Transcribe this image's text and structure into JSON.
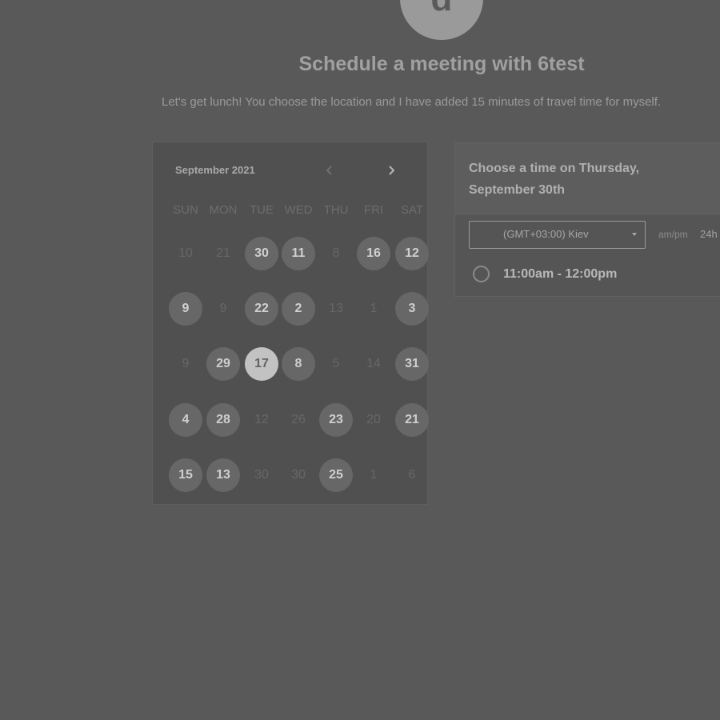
{
  "header": {
    "avatar_letter": "d",
    "title": "Schedule a meeting with 6test",
    "description": "Let's get lunch! You choose the location and I have added 15 minutes of travel time for myself."
  },
  "calendar": {
    "month_label": "September 2021",
    "prev_icon": "chevron-left-icon",
    "next_icon": "chevron-right-icon",
    "weekdays": [
      "SUN",
      "MON",
      "TUE",
      "WED",
      "THU",
      "FRI",
      "SAT"
    ],
    "weeks": [
      [
        {
          "label": "10",
          "state": "inactive"
        },
        {
          "label": "21",
          "state": "inactive"
        },
        {
          "label": "30",
          "state": "available"
        },
        {
          "label": "11",
          "state": "available"
        },
        {
          "label": "8",
          "state": "inactive"
        },
        {
          "label": "16",
          "state": "available"
        },
        {
          "label": "12",
          "state": "available"
        }
      ],
      [
        {
          "label": "9",
          "state": "available"
        },
        {
          "label": "9",
          "state": "inactive"
        },
        {
          "label": "22",
          "state": "available"
        },
        {
          "label": "2",
          "state": "available"
        },
        {
          "label": "13",
          "state": "inactive"
        },
        {
          "label": "1",
          "state": "inactive"
        },
        {
          "label": "3",
          "state": "available"
        }
      ],
      [
        {
          "label": "9",
          "state": "inactive"
        },
        {
          "label": "29",
          "state": "available"
        },
        {
          "label": "17",
          "state": "selected"
        },
        {
          "label": "8",
          "state": "available"
        },
        {
          "label": "5",
          "state": "inactive"
        },
        {
          "label": "14",
          "state": "inactive"
        },
        {
          "label": "31",
          "state": "available"
        }
      ],
      [
        {
          "label": "4",
          "state": "available"
        },
        {
          "label": "28",
          "state": "available"
        },
        {
          "label": "12",
          "state": "inactive"
        },
        {
          "label": "26",
          "state": "inactive"
        },
        {
          "label": "23",
          "state": "available"
        },
        {
          "label": "20",
          "state": "inactive"
        },
        {
          "label": "21",
          "state": "available"
        }
      ],
      [
        {
          "label": "15",
          "state": "available"
        },
        {
          "label": "13",
          "state": "available"
        },
        {
          "label": "30",
          "state": "inactive"
        },
        {
          "label": "30",
          "state": "inactive"
        },
        {
          "label": "25",
          "state": "available"
        },
        {
          "label": "1",
          "state": "inactive"
        },
        {
          "label": "6",
          "state": "inactive"
        }
      ]
    ]
  },
  "time_panel": {
    "heading": "Choose a time on Thursday, September 30th",
    "timezone_value": "(GMT+03:00) Kiev",
    "format_ampm": "am/pm",
    "format_24h": "24h",
    "slots": [
      {
        "label": "11:00am - 12:00pm"
      }
    ]
  },
  "colors": {
    "overlay_background": "#595959",
    "selected_day": "#c2c2c2",
    "available_day": "#676767"
  }
}
